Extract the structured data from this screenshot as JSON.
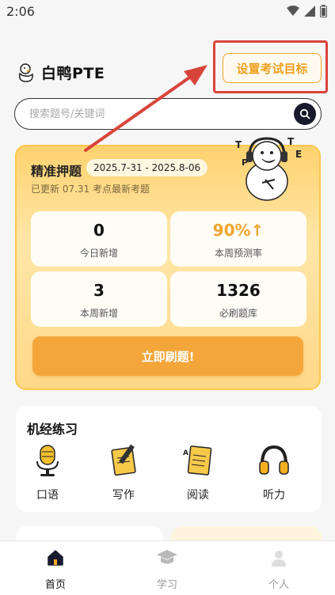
{
  "status": {
    "time": "2:06"
  },
  "header": {
    "app_name": "白鸭PTE",
    "goal_button": "设置考试目标"
  },
  "search": {
    "placeholder": "搜索题号/关键词"
  },
  "prediction": {
    "title": "精准押题",
    "date_range": "2025.7-31 - 2025.8-06",
    "update_note": "已更新 07.31 考点最新考题",
    "stats": [
      {
        "value": "0",
        "label": "今日新增"
      },
      {
        "value": "90%↑",
        "label": "本周预测率"
      },
      {
        "value": "3",
        "label": "本周新增"
      },
      {
        "value": "1326",
        "label": "必刷题库"
      }
    ],
    "cta": "立即刷题!"
  },
  "practice": {
    "title": "机经练习",
    "items": [
      {
        "label": "口语",
        "icon": "microphone-icon"
      },
      {
        "label": "写作",
        "icon": "notepad-pencil-icon"
      },
      {
        "label": "阅读",
        "icon": "document-icon"
      },
      {
        "label": "听力",
        "icon": "headphones-icon"
      }
    ]
  },
  "bottom_nav": [
    {
      "label": "首页",
      "icon": "home-icon",
      "active": true
    },
    {
      "label": "学习",
      "icon": "graduation-cap-icon",
      "active": false
    },
    {
      "label": "个人",
      "icon": "profile-icon",
      "active": false
    }
  ],
  "colors": {
    "accent": "#f5a63a",
    "highlight": "#d9443a",
    "card_bg": "#ffd889"
  }
}
